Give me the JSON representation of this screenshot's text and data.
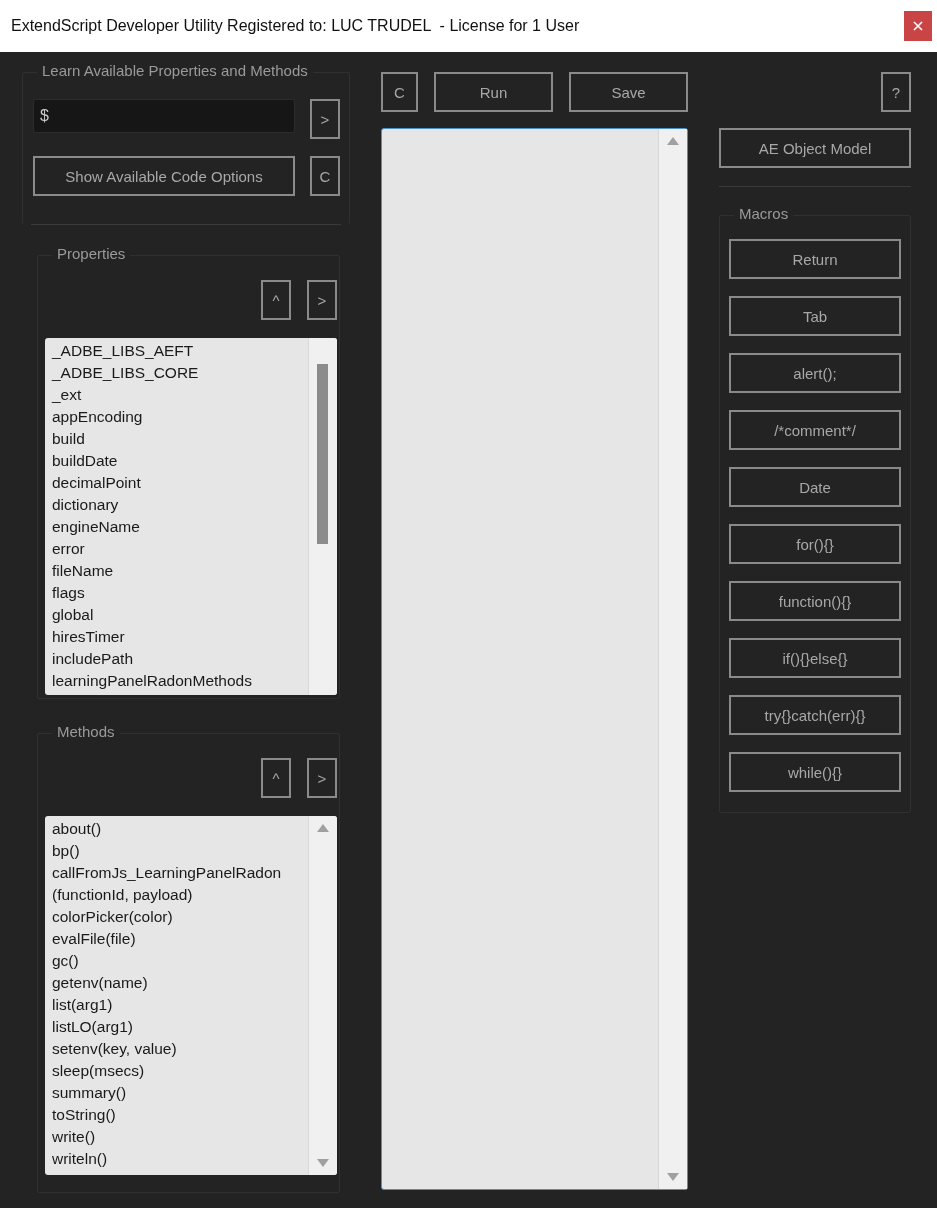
{
  "window": {
    "title": "ExtendScript Developer Utility Registered to: LUC TRUDEL  - License for 1 User"
  },
  "learn": {
    "title": "Learn Available Properties and Methods",
    "field": {
      "value": "$"
    },
    "go_button": ">",
    "show_button": "Show Available Code Options",
    "clear_button": "C"
  },
  "properties": {
    "title": "Properties",
    "up_button": "^",
    "go_button": ">",
    "items": [
      "_ADBE_LIBS_AEFT",
      "_ADBE_LIBS_CORE",
      "_ext",
      "appEncoding",
      "build",
      "buildDate",
      "decimalPoint",
      "dictionary",
      "engineName",
      "error",
      "fileName",
      "flags",
      "global",
      "hiresTimer",
      "includePath",
      "learningPanelRadonMethods"
    ]
  },
  "methods": {
    "title": "Methods",
    "up_button": "^",
    "go_button": ">",
    "items": [
      "about()",
      "bp()",
      "callFromJs_LearningPanelRadon",
      "(functionId, payload)",
      "colorPicker(color)",
      "evalFile(file)",
      "gc()",
      "getenv(name)",
      "list(arg1)",
      "listLO(arg1)",
      "setenv(key, value)",
      "sleep(msecs)",
      "summary()",
      "toString()",
      "write()",
      "writeln()"
    ]
  },
  "editor": {
    "clear_button": "C",
    "run_button": "Run",
    "save_button": "Save"
  },
  "help_button": "?",
  "object_model_button": "AE Object Model",
  "macros": {
    "title": "Macros",
    "buttons": [
      "Return",
      "Tab",
      "alert();",
      "/*comment*/",
      "Date",
      "for(){}",
      "function(){}",
      "if(){}else{}",
      "try{}catch(err){}",
      "while(){}"
    ]
  }
}
